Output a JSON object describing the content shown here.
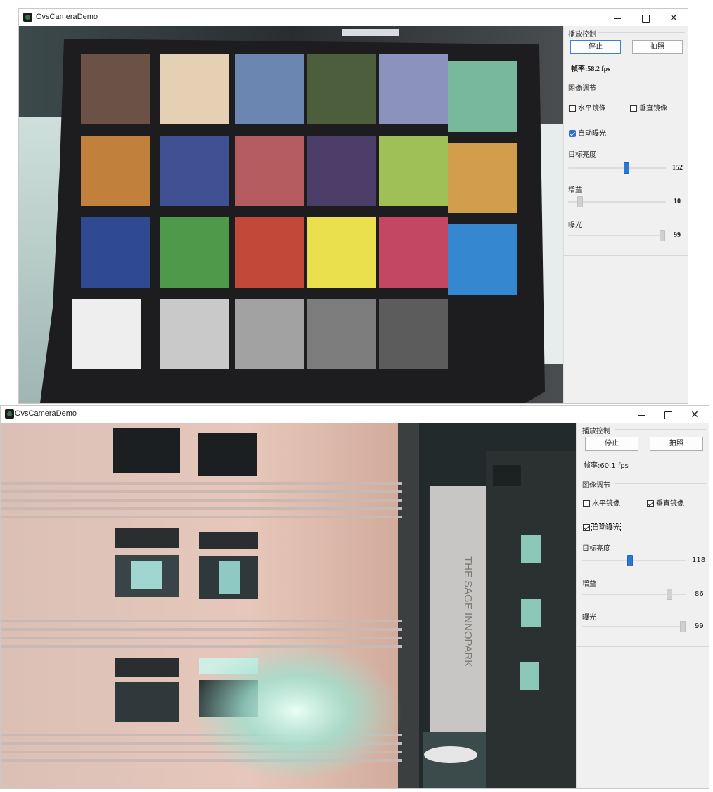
{
  "window1": {
    "title": "OvsCameraDemo",
    "controls": {
      "minimize": "—",
      "close": "✕"
    },
    "playback": {
      "group_title": "播放控制",
      "stop_label": "停止",
      "photo_label": "拍照",
      "fps_text": "帧率:58.2 fps"
    },
    "image": {
      "group_title": "图像调节",
      "h_mirror": {
        "label": "水平镜像",
        "checked": false
      },
      "v_mirror": {
        "label": "垂直镜像",
        "checked": false
      },
      "auto_exposure": {
        "label": "自动曝光",
        "checked": true
      },
      "brightness": {
        "label": "目标亮度",
        "value": "152",
        "level": 0.6
      },
      "gain": {
        "label": "增益",
        "value": "10",
        "level": 0.1
      },
      "exposure": {
        "label": "曝光",
        "value": "99",
        "level": 0.99
      }
    }
  },
  "window2": {
    "title": "OvsCameraDemo",
    "controls": {
      "minimize": "—",
      "close": "✕"
    },
    "playback": {
      "group_title": "播放控制",
      "stop_label": "停止",
      "photo_label": "拍照",
      "fps_text": "帧率:60.1 fps"
    },
    "image": {
      "group_title": "图像调节",
      "h_mirror": {
        "label": "水平镜像",
        "checked": false
      },
      "v_mirror": {
        "label": "垂直镜像",
        "checked": true
      },
      "auto_exposure": {
        "label": "自动曝光",
        "checked": true
      },
      "brightness": {
        "label": "目标亮度",
        "value": "118",
        "level": 0.46
      },
      "gain": {
        "label": "增益",
        "value": "86",
        "level": 0.86
      },
      "exposure": {
        "label": "曝光",
        "value": "99",
        "level": 0.99
      }
    },
    "feed_text": "THE SAGE INNOPARK"
  },
  "colors": {
    "accent": "#2a78d4",
    "checker_patches": [
      [
        "#6b5146",
        "#e6d0b4",
        "#6b86b0",
        "#4d5e3c",
        "#8b92bd",
        "#78b89c"
      ],
      [
        "#c2803d",
        "#3f5192",
        "#b45c5f",
        "#4d3d69",
        "#9fbf57",
        "#d29e4b"
      ],
      [
        "#2f4a91",
        "#4f9a4a",
        "#c2493a",
        "#eadf4d",
        "#c34662",
        "#3588d0"
      ],
      [
        "#eeeeee",
        "#c9c9c9",
        "#a2a2a2",
        "#7d7d7d",
        "#5c5c5c",
        "#3a3a3a"
      ]
    ]
  }
}
